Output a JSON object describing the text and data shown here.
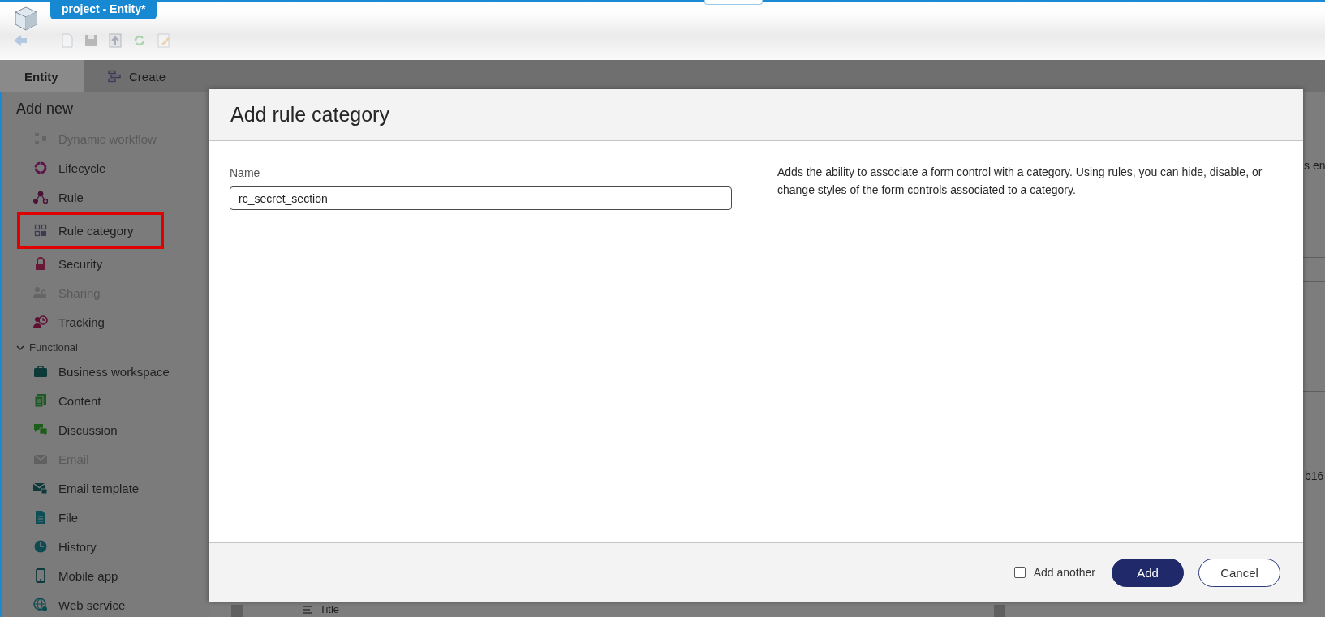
{
  "window": {
    "title": "project - Entity*"
  },
  "tabs": [
    {
      "label": "Entity",
      "selected": true
    },
    {
      "label": "Create",
      "selected": false
    }
  ],
  "sidebar": {
    "heading": "Add new",
    "items": [
      {
        "label": "Dynamic workflow",
        "disabled": true,
        "highlighted": false
      },
      {
        "label": "Lifecycle",
        "disabled": false,
        "highlighted": false
      },
      {
        "label": "Rule",
        "disabled": false,
        "highlighted": false
      },
      {
        "label": "Rule category",
        "disabled": false,
        "highlighted": true
      },
      {
        "label": "Security",
        "disabled": false,
        "highlighted": false
      },
      {
        "label": "Sharing",
        "disabled": true,
        "highlighted": false
      },
      {
        "label": "Tracking",
        "disabled": false,
        "highlighted": false
      }
    ],
    "group": {
      "label": "Functional",
      "expanded": true,
      "items": [
        {
          "label": "Business workspace",
          "disabled": false,
          "highlighted": false
        },
        {
          "label": "Content",
          "disabled": false,
          "highlighted": false
        },
        {
          "label": "Discussion",
          "disabled": false,
          "highlighted": false
        },
        {
          "label": "Email",
          "disabled": true,
          "highlighted": false
        },
        {
          "label": "Email template",
          "disabled": false,
          "highlighted": false
        },
        {
          "label": "File",
          "disabled": false,
          "highlighted": false
        },
        {
          "label": "History",
          "disabled": false,
          "highlighted": false
        },
        {
          "label": "Mobile app",
          "disabled": false,
          "highlighted": false
        },
        {
          "label": "Web service",
          "disabled": false,
          "highlighted": false
        }
      ]
    }
  },
  "background": {
    "fragments": [
      "s en",
      "b16"
    ],
    "list_item": "Title"
  },
  "dialog": {
    "title": "Add rule category",
    "field": {
      "label": "Name",
      "value": "rc_secret_section"
    },
    "description": "Adds the ability to associate a form control with a category. Using rules, you can hide, disable, or change styles of the form controls associated to a category.",
    "add_another": {
      "label": "Add another",
      "checked": false
    },
    "buttons": [
      {
        "label": "Add",
        "kind": "primary"
      },
      {
        "label": "Cancel",
        "kind": "secondary"
      }
    ]
  }
}
